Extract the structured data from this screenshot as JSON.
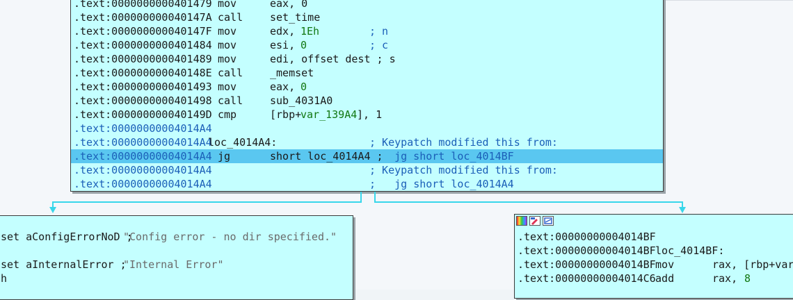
{
  "main_block": {
    "lines": [
      {
        "addr": ".text:0000000000401479",
        "mnem": "mov",
        "op": "eax, 0",
        "highlight": false,
        "blue_addr": false
      },
      {
        "addr": ".text:000000000040147A",
        "mnem": "call",
        "op": "set_time",
        "highlight": false,
        "blue_addr": false
      },
      {
        "addr": ".text:000000000040147F",
        "mnem": "mov",
        "op_a": "edx, ",
        "op_num": "1Eh",
        "op_cmt": "; n",
        "highlight": false,
        "blue_addr": false
      },
      {
        "addr": ".text:0000000000401484",
        "mnem": "mov",
        "op_a": "esi, ",
        "op_num": "0",
        "op_cmt": "; c",
        "highlight": false,
        "blue_addr": false
      },
      {
        "addr": ".text:0000000000401489",
        "mnem": "mov",
        "op": "edi, offset dest ; s",
        "highlight": false,
        "blue_addr": false
      },
      {
        "addr": ".text:000000000040148E",
        "mnem": "call",
        "op": "_memset",
        "highlight": false,
        "blue_addr": false
      },
      {
        "addr": ".text:0000000000401493",
        "mnem": "mov",
        "op_a": "eax, ",
        "op_num": "0",
        "highlight": false,
        "blue_addr": false
      },
      {
        "addr": ".text:0000000000401498",
        "mnem": "call",
        "op": "sub_4031A0",
        "highlight": false,
        "blue_addr": false
      },
      {
        "addr": ".text:000000000040149D",
        "mnem": "cmp",
        "op_a": "[rbp+",
        "op_num": "var_139A4",
        "op_b": "], 1",
        "highlight": false,
        "blue_addr": false
      },
      {
        "addr": ".text:00000000004014A4",
        "mnem": "",
        "op": "",
        "highlight": false,
        "blue_addr": true
      },
      {
        "addr": ".text:00000000004014A4",
        "label": "loc_4014A4:",
        "cmt": "; Keypatch modified this from:",
        "highlight": false,
        "blue_addr": true
      },
      {
        "addr": ".text:00000000004014A4",
        "mnem": "jg",
        "op": "short loc_4014A4 ;",
        "cmt": "   jg short loc_4014BF",
        "highlight": true,
        "blue_addr": true
      },
      {
        "addr": ".text:00000000004014A4",
        "cmt": "; Keypatch modified this from:",
        "highlight": false,
        "blue_addr": true
      },
      {
        "addr": ".text:00000000004014A4",
        "cmt": ";   jg short loc_4014A4",
        "highlight": false,
        "blue_addr": true
      }
    ]
  },
  "left_block": {
    "lines": [
      {
        "pre": "set aConfigErrorNoD ; ",
        "str": "\"Config error - no dir specified.\""
      },
      {
        "pre": "",
        "str": ""
      },
      {
        "pre": "set aInternalError ; ",
        "str": "\"Internal Error\""
      },
      {
        "pre": "h",
        "str": ""
      }
    ]
  },
  "right_block": {
    "icons": [
      "palette-icon",
      "edit-icon",
      "graph-icon"
    ],
    "lines": [
      {
        "addr": ".text:00000000004014BF",
        "text": ""
      },
      {
        "addr": ".text:00000000004014BF",
        "text": " loc_4014BF:"
      },
      {
        "addr": ".text:00000000004014BF",
        "mnem": " mov",
        "op": "rax, [rbp+var_"
      },
      {
        "addr": ".text:00000000004014C6",
        "mnem": " add",
        "op_a": "rax, ",
        "op_num": "8"
      }
    ]
  },
  "colors": {
    "node_bg": "#c4ffff",
    "highlight": "#5ac7f0",
    "edge": "#38d7ea",
    "comment": "#1b5fb8",
    "number": "#117711"
  }
}
